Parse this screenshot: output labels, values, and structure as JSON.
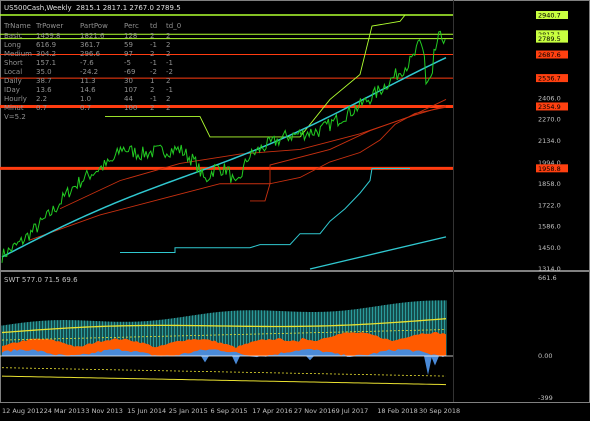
{
  "title": "US500Cash,Weekly",
  "ohlc": "2815.1 2817.1 2767.0 2789.5",
  "table": {
    "headers": [
      "TrName",
      "TrPower",
      "PartPow",
      "Perc",
      "td",
      "td_0"
    ],
    "rows": [
      [
        "Basic",
        "1459.8",
        "1821.6",
        "128",
        "2",
        "2"
      ],
      [
        "Long",
        "616.9",
        "361.7",
        "59",
        "-1",
        "2"
      ],
      [
        "Medium",
        "304.2",
        "296.6",
        "97",
        "2",
        "2"
      ],
      [
        "Short",
        "157.1",
        "-7.6",
        "-5",
        "-1",
        "-1"
      ],
      [
        "Local",
        "35.0",
        "-24.2",
        "-69",
        "-2",
        "-2"
      ],
      [
        "Daily",
        "38.7",
        "11.3",
        "30",
        "1",
        "2"
      ],
      [
        "IDay",
        "13.6",
        "14.6",
        "107",
        "2",
        "-1"
      ],
      [
        "Hourly",
        "2.2",
        "1.0",
        "44",
        "-1",
        "2"
      ],
      [
        "Minut",
        "0.7",
        "0.7",
        "100",
        "2",
        "2"
      ]
    ],
    "footer": "V=5.2"
  },
  "price_axis": {
    "ticks": [
      "2406.0",
      "2270.0",
      "2134.0",
      "1994.0",
      "1858.0",
      "1722.0",
      "1586.0",
      "1450.0",
      "1314.0"
    ],
    "badges": [
      {
        "text": "2940.7",
        "color": "#c8ff40",
        "y": 2940.7
      },
      {
        "text": "2817.1",
        "color": "#c8ff40",
        "y": 2817.1
      },
      {
        "text": "2789.5",
        "color": "#c8ff40",
        "y": 2789.5
      },
      {
        "text": "2687.6",
        "color": "#ff4010",
        "y": 2687.6
      },
      {
        "text": "2536.7",
        "color": "#ff4010",
        "y": 2536.7
      },
      {
        "text": "2354.9",
        "color": "#ff4010",
        "y": 2354.9
      },
      {
        "text": "1958.8",
        "color": "#ff4010",
        "y": 1958.8
      }
    ]
  },
  "indicator": {
    "label": "SWT 577.0 71.5 69.6",
    "ticks": [
      "661.6",
      "0.00",
      "-399"
    ]
  },
  "date_axis": [
    "12 Aug 2012",
    "24 Mar 2013",
    "3 Nov 2013",
    "15 Jun 2014",
    "25 Jan 2015",
    "6 Sep 2015",
    "17 Apr 2016",
    "27 Nov 2016",
    "9 Jul 2017",
    "18 Feb 2018",
    "30 Sep 2018"
  ],
  "colors": {
    "price": "#22cc22",
    "ma_cyan": "#30c8d0",
    "level_green": "#b0ff30",
    "level_red": "#ff3c10",
    "envelope": "#c83010",
    "indicator_teal": "#2a9a9a",
    "indicator_orange": "#ff5a00",
    "indicator_blue": "#4a8ad8",
    "indicator_yellow": "#e8e030"
  }
}
